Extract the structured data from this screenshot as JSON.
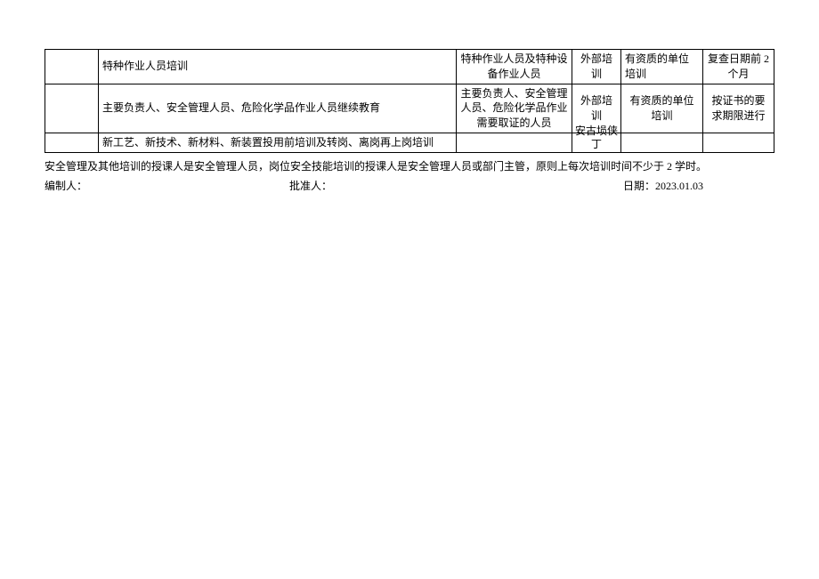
{
  "table": {
    "rows": [
      {
        "col_a": "",
        "col_b": "特种作业人员培训",
        "col_c": "特种作业人员及特种设备作业人员",
        "col_d": "外部培训",
        "col_e": "有资质的单位培训",
        "col_f": "复查日期前 2个月"
      },
      {
        "col_a": "",
        "col_b": "主要负责人、安全管理人员、危险化学品作业人员继续教育",
        "col_c": "主要负责人、安全管理人员、危险化学品作业需要取证的人员",
        "col_d": "外部培训",
        "col_e": "有资质的单位培训",
        "col_f": "按证书的要求期限进行"
      },
      {
        "col_a": "",
        "col_b": "新工艺、新技术、新材料、新装置投用前培训及转岗、离岗再上岗培训",
        "col_c": "",
        "col_d": "安古埙侠丁",
        "col_e": "",
        "col_f": ""
      }
    ]
  },
  "note": "安全管理及其他培训的授课人是安全管理人员，岗位安全技能培训的授课人是安全管理人员或部门主管，原则上每次培训时间不少于 2 学时。",
  "signature": {
    "author": "编制人：",
    "approver": "批准人：",
    "date_label": "日期：",
    "date_value": "2023.01.03"
  }
}
